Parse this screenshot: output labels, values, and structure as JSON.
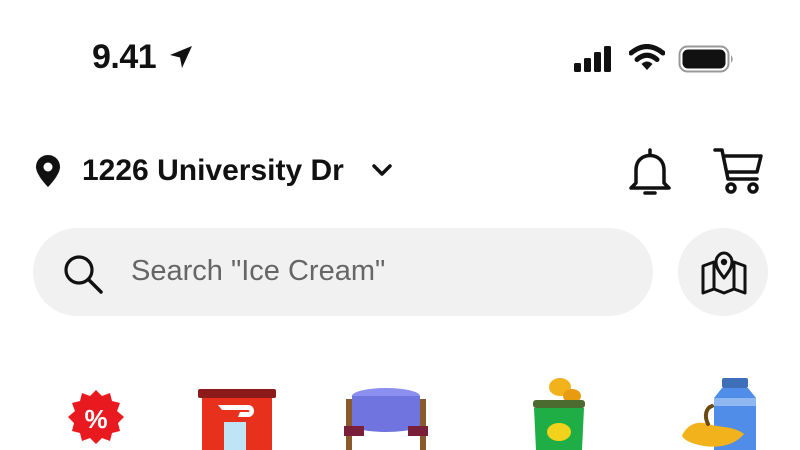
{
  "status_bar": {
    "time": "9.41",
    "location_icon": "location-arrow-icon",
    "signal_icon": "signal-icon",
    "wifi_icon": "wifi-icon",
    "battery_icon": "battery-icon"
  },
  "header": {
    "address": "1226 University Dr",
    "address_icon": "location-pin-icon",
    "dropdown_icon": "chevron-down-icon",
    "notifications_icon": "bell-icon",
    "cart_icon": "cart-icon"
  },
  "search": {
    "placeholder": "Search \"Ice Cream\"",
    "icon": "search-icon",
    "map_button_icon": "map-icon"
  },
  "categories": [
    {
      "icon": "deals-badge-icon"
    },
    {
      "icon": "dashpass-store-icon"
    },
    {
      "icon": "dine-in-table-icon"
    },
    {
      "icon": "snacks-bag-icon"
    },
    {
      "icon": "grocery-icon"
    }
  ],
  "colors": {
    "search_bg": "#f1f1f1",
    "deals_red": "#e8191f",
    "store_red": "#e8311d",
    "table_blue": "#8a8ff0",
    "snack_green": "#1fae46",
    "milk_blue": "#4f8de8",
    "banana_yellow": "#f2b21b"
  }
}
